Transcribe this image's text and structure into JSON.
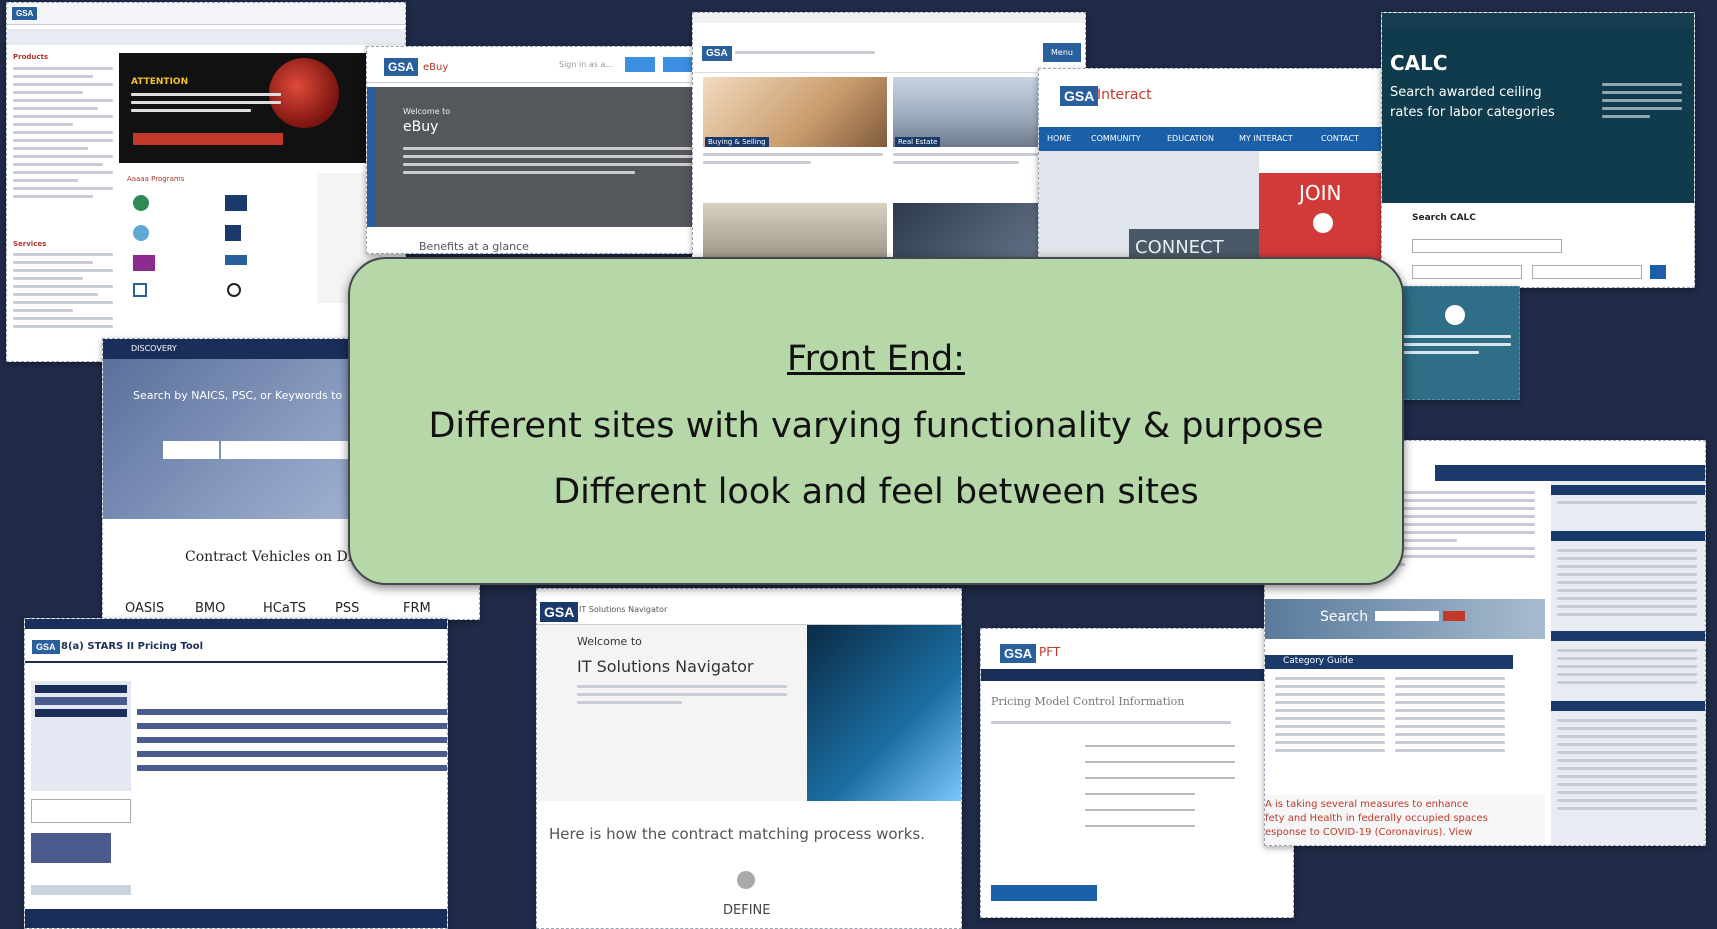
{
  "callout": {
    "heading": "Front End:",
    "line1": "Different sites with varying functionality & purpose",
    "line2": "Different look and feel between sites"
  },
  "screenshots": {
    "advantage": {
      "logo": "GSA",
      "banner": "ATTENTION",
      "sidebar_products": "Products",
      "sidebar_services": "Services",
      "section_programs": "Aaaaa Programs"
    },
    "ebuy": {
      "logo": "GSA",
      "app": "eBuy",
      "signin": "Sign in as a...",
      "welcome": "Welcome to",
      "title": "eBuy",
      "benefits": "Benefits at a glance"
    },
    "gsa_home": {
      "logo": "GSA",
      "menu": "Menu",
      "tile1": "Buying & Selling",
      "tile2": "Real Estate"
    },
    "interact": {
      "logo": "GSA",
      "name": "Interact",
      "nav": [
        "HOME",
        "COMMUNITY",
        "EDUCATION",
        "MY INTERACT",
        "CONTACT"
      ],
      "join": "JOIN",
      "connect": "CONNECT"
    },
    "calc": {
      "title": "CALC",
      "subtitle1": "Search awarded ceiling",
      "subtitle2": "rates for labor categories",
      "search_label": "Search CALC"
    },
    "discovery": {
      "label": "DISCOVERY",
      "search_prompt": "Search by NAICS, PSC, or Keywords to",
      "contracts": "Contract Vehicles on Dis",
      "vehicles": [
        "OASIS",
        "BMO",
        "HCaTS",
        "PSS",
        "FRM"
      ]
    },
    "stars": {
      "logo": "GSA",
      "title": "8(a) STARS II Pricing Tool"
    },
    "navigator": {
      "logo": "GSA",
      "app": "IT Solutions Navigator",
      "welcome": "Welcome to",
      "title": "IT Solutions Navigator",
      "process": "Here is how the contract matching process works.",
      "step": "DEFINE"
    },
    "pft": {
      "logo": "GSA",
      "app": "PFT",
      "heading": "Pricing Model Control Information"
    },
    "fas": {
      "search": "Search",
      "category": "Category Guide",
      "alert1": "A is taking several measures to enhance",
      "alert2": "fety and Health in federally occupied spaces",
      "alert3": "esponse to COVID-19 (Coronavirus). View"
    }
  },
  "colors": {
    "background": "#1f2b47",
    "callout_fill": "#b6d7a8",
    "gsa_blue": "#2a5f9e"
  }
}
